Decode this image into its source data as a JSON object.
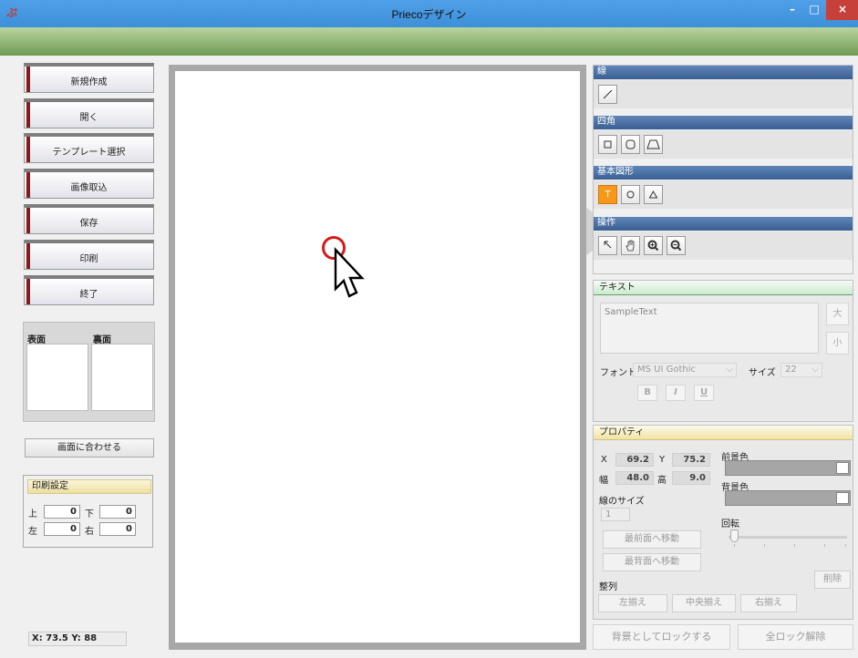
{
  "window": {
    "title": "Priecoデザイン",
    "min_glyph": "–",
    "max_glyph": "□",
    "close_glyph": "×"
  },
  "menu": {
    "new": "新規作成",
    "open": "開く",
    "template": "テンプレート選択",
    "import_image": "画像取込",
    "save": "保存",
    "print": "印刷",
    "exit": "終了"
  },
  "faces": {
    "front": "表面",
    "back": "裏面"
  },
  "fit_button": "画面に合わせる",
  "print_settings": {
    "title": "印刷設定",
    "top_label": "上",
    "top_value": "0",
    "bottom_label": "下",
    "bottom_value": "0",
    "left_label": "左",
    "left_value": "0",
    "right_label": "右",
    "right_value": "0"
  },
  "status": {
    "coords": "X: 73.5  Y: 88"
  },
  "tools": {
    "line_head": "線",
    "rect_head": "四角",
    "basic_head": "基本図形",
    "op_head": "操作",
    "text_tool": "T"
  },
  "text_panel": {
    "title": "テキスト",
    "sample": "SampleText",
    "big": "大",
    "small": "小",
    "font_label": "フォント",
    "font_value": "MS UI Gothic",
    "size_label": "サイズ",
    "size_value": "22",
    "bold": "B",
    "italic": "I",
    "underline": "U"
  },
  "props": {
    "title": "プロパティ",
    "x_label": "X",
    "x_value": "69.2",
    "y_label": "Y",
    "y_value": "75.2",
    "w_label": "幅",
    "w_value": "48.0",
    "h_label": "高",
    "h_value": "9.0",
    "line_size_label": "線のサイズ",
    "line_size_value": "1",
    "fg_label": "前景色",
    "bg_label": "背景色",
    "rotate_label": "回転",
    "bring_front": "最前面へ移動",
    "send_back": "最背面へ移動",
    "delete": "削除",
    "align_label": "整列",
    "align_left": "左揃え",
    "align_center": "中央揃え",
    "align_right": "右揃え"
  },
  "bottom": {
    "lock_bg": "背景としてロックする",
    "unlock_all": "全ロック解除"
  },
  "colors": {
    "accent_orange": "#f7981d",
    "section_blue": "#3a5f93",
    "close_red": "#c7403a"
  }
}
